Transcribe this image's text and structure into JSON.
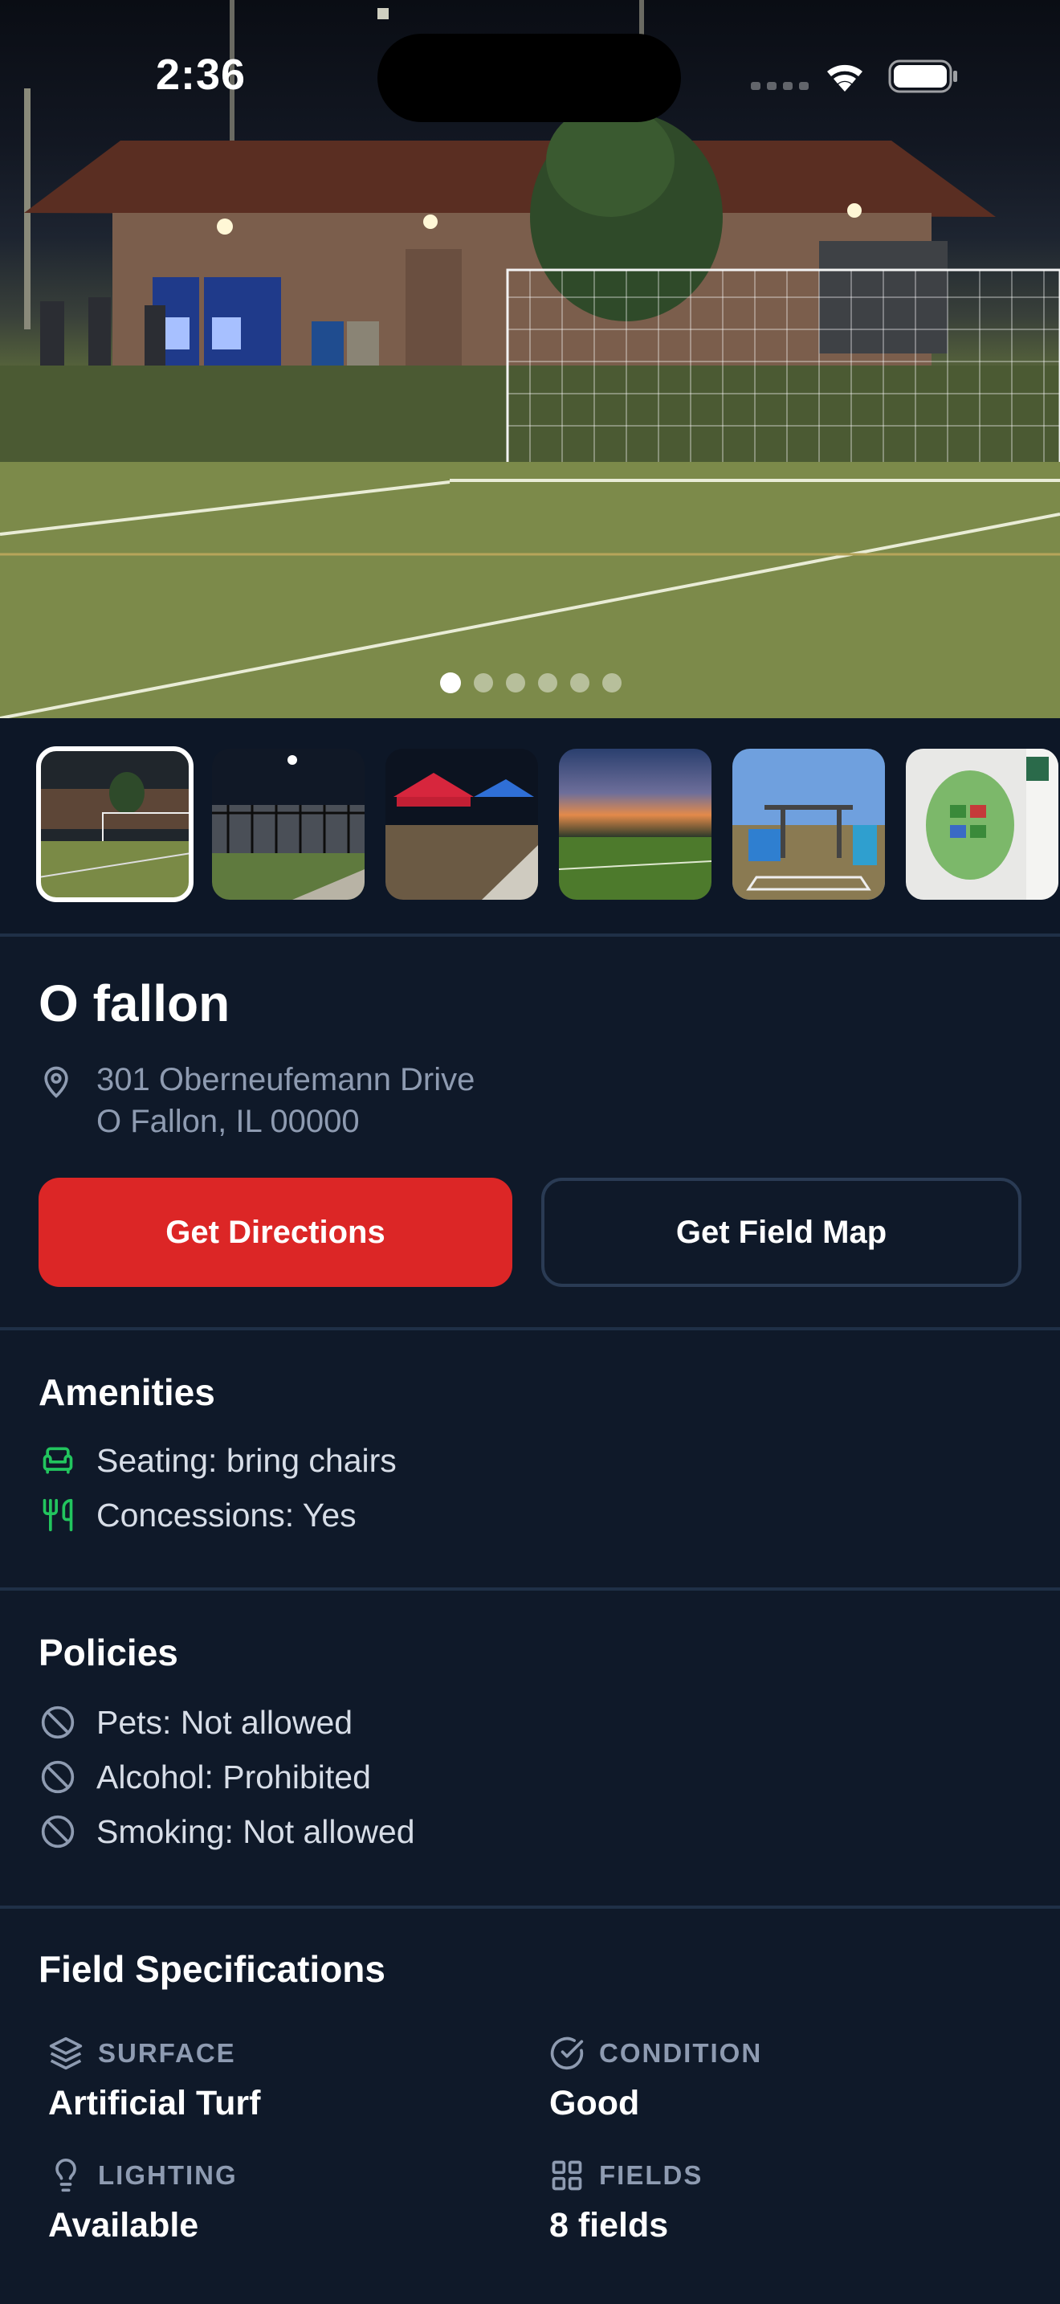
{
  "status_bar": {
    "time": "2:36"
  },
  "hero": {
    "image": "soccer-field-night-photo",
    "page_count": 6,
    "active_page": 1
  },
  "thumbnails": [
    {
      "name": "field-goal-photo",
      "selected": true
    },
    {
      "name": "bleachers-photo",
      "selected": false
    },
    {
      "name": "tents-photo",
      "selected": false
    },
    {
      "name": "sunset-field-photo",
      "selected": false
    },
    {
      "name": "playground-photo",
      "selected": false
    },
    {
      "name": "park-map-photo",
      "selected": false
    }
  ],
  "venue": {
    "name": "O fallon",
    "address_line1": "301 Oberneufemann Drive",
    "address_line2": "O Fallon, IL 00000"
  },
  "actions": {
    "directions_label": "Get Directions",
    "field_map_label": "Get Field Map"
  },
  "amenities": {
    "title": "Amenities",
    "items": [
      {
        "icon": "armchair-icon",
        "text": "Seating: bring chairs"
      },
      {
        "icon": "utensils-icon",
        "text": "Concessions: Yes"
      }
    ]
  },
  "policies": {
    "title": "Policies",
    "items": [
      {
        "icon": "ban-icon",
        "text": "Pets: Not allowed"
      },
      {
        "icon": "ban-icon",
        "text": "Alcohol: Prohibited"
      },
      {
        "icon": "ban-icon",
        "text": "Smoking: Not allowed"
      }
    ]
  },
  "specs": {
    "title": "Field Specifications",
    "items": [
      {
        "icon": "layers-icon",
        "label": "SURFACE",
        "value": "Artificial Turf"
      },
      {
        "icon": "check-circle-icon",
        "label": "CONDITION",
        "value": "Good"
      },
      {
        "icon": "lightbulb-icon",
        "label": "LIGHTING",
        "value": "Available"
      },
      {
        "icon": "grid-icon",
        "label": "FIELDS",
        "value": "8 fields"
      }
    ]
  },
  "colors": {
    "background": "#0f1929",
    "primary_red": "#dc2626",
    "amenity_green": "#22c55e",
    "muted_text": "#8e9bb1"
  }
}
